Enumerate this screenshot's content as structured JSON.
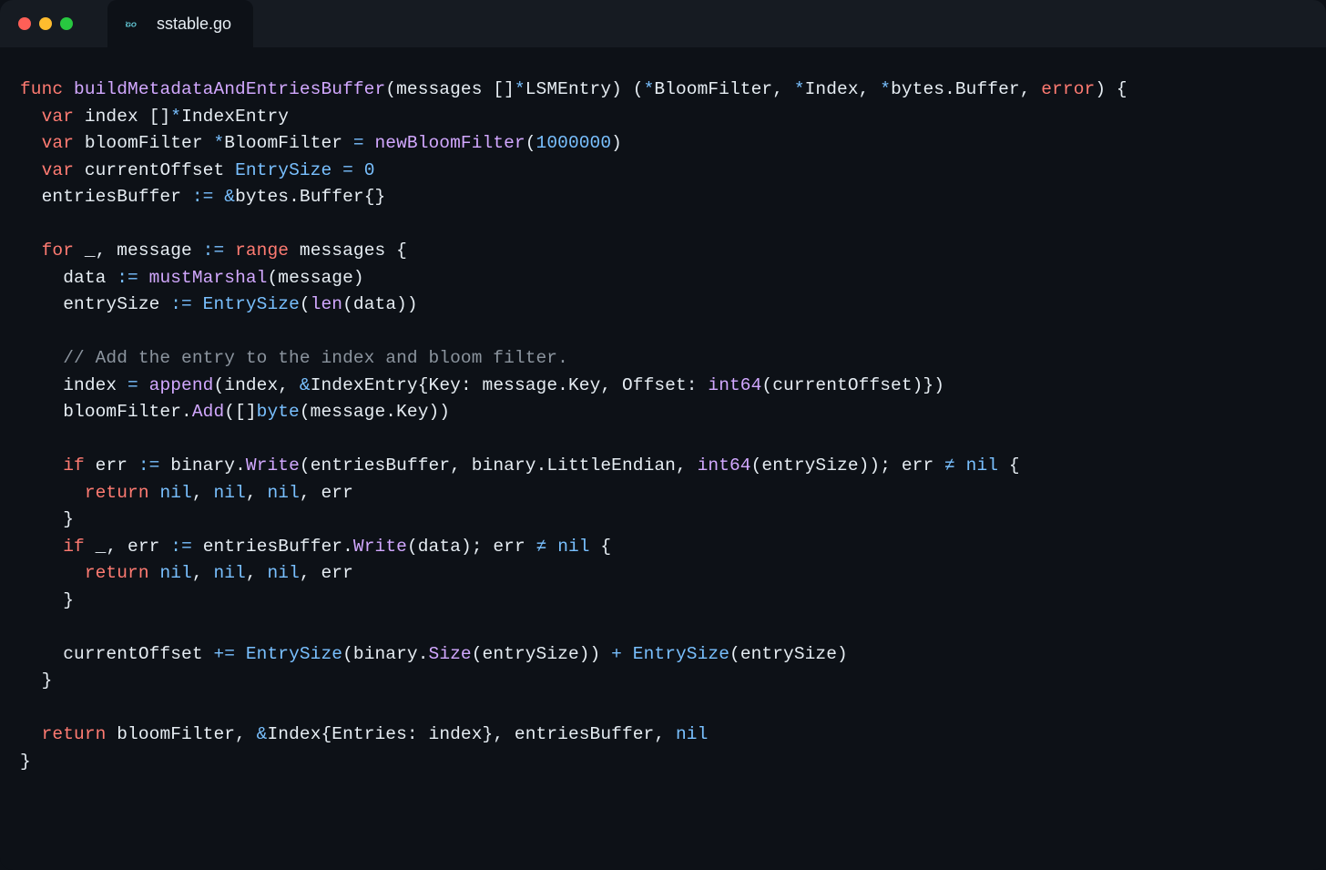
{
  "tab": {
    "filename": "sstable.go",
    "icon_label": "GO"
  },
  "code": {
    "l1": {
      "kw_func": "func",
      "fn": "buildMetadataAndEntriesBuffer",
      "params": "(messages []",
      "star1": "*",
      "t1": "LSMEntry",
      "close": ") (",
      "star2": "*",
      "t2": "BloomFilter",
      "c1": ", ",
      "star3": "*",
      "t3": "Index",
      "c2": ", ",
      "star4": "*",
      "t4": "bytes.Buffer",
      "c3": ", ",
      "err": "error",
      "end": ") {"
    },
    "l2": {
      "indent": "  ",
      "kw": "var",
      "sp": " ",
      "id": "index []",
      "star": "*",
      "typ": "IndexEntry"
    },
    "l3": {
      "indent": "  ",
      "kw": "var",
      "sp": " ",
      "id": "bloomFilter ",
      "star": "*",
      "typ": "BloomFilter",
      "eq": " = ",
      "fn": "newBloomFilter",
      "open": "(",
      "num": "1000000",
      "close": ")"
    },
    "l4": {
      "indent": "  ",
      "kw": "var",
      "sp": " ",
      "id": "currentOffset ",
      "typ": "EntrySize",
      "eq": " = ",
      "num": "0"
    },
    "l5": {
      "indent": "  ",
      "id": "entriesBuffer ",
      "op": ":=",
      "sp": " ",
      "amp": "&",
      "typ": "bytes.Buffer",
      "br": "{}"
    },
    "l6": "",
    "l7": {
      "indent": "  ",
      "kw_for": "for",
      "sp": " ",
      "us": "_, message ",
      "op": ":=",
      "sp2": " ",
      "kw_range": "range",
      "sp3": " ",
      "id": "messages {"
    },
    "l8": {
      "indent": "    ",
      "id": "data ",
      "op": ":=",
      "sp": " ",
      "fn": "mustMarshal",
      "args": "(message)"
    },
    "l9": {
      "indent": "    ",
      "id": "entrySize ",
      "op": ":=",
      "sp": " ",
      "typ": "EntrySize",
      "open": "(",
      "fn": "len",
      "args": "(data))"
    },
    "l10": "",
    "l11": {
      "indent": "    ",
      "cmt": "// Add the entry to the index and bloom filter."
    },
    "l12": {
      "indent": "    ",
      "id": "index ",
      "eq": "=",
      "sp": " ",
      "fn": "append",
      "open": "(index, ",
      "amp": "&",
      "typ": "IndexEntry",
      "body": "{Key: message.Key, Offset: ",
      "fn2": "int64",
      "args": "(currentOffset)})"
    },
    "l13": {
      "indent": "    ",
      "id": "bloomFilter.",
      "fn": "Add",
      "open": "([]",
      "typ": "byte",
      "args": "(message.Key))"
    },
    "l14": "",
    "l15": {
      "indent": "    ",
      "kw": "if",
      "sp": " ",
      "id": "err ",
      "op": ":=",
      "sp2": " ",
      "id2": "binary.",
      "fn": "Write",
      "args": "(entriesBuffer, binary.LittleEndian, ",
      "fn2": "int64",
      "args2": "(entrySize)); err ",
      "neq": "≠",
      "sp3": " ",
      "nil": "nil",
      "end": " {"
    },
    "l16": {
      "indent": "      ",
      "kw": "return",
      "sp": " ",
      "nil1": "nil",
      "c1": ", ",
      "nil2": "nil",
      "c2": ", ",
      "nil3": "nil",
      "c3": ", err"
    },
    "l17": {
      "indent": "    ",
      "br": "}"
    },
    "l18": {
      "indent": "    ",
      "kw": "if",
      "sp": " ",
      "id": "_, err ",
      "op": ":=",
      "sp2": " ",
      "id2": "entriesBuffer.",
      "fn": "Write",
      "args": "(data); err ",
      "neq": "≠",
      "sp3": " ",
      "nil": "nil",
      "end": " {"
    },
    "l19": {
      "indent": "      ",
      "kw": "return",
      "sp": " ",
      "nil1": "nil",
      "c1": ", ",
      "nil2": "nil",
      "c2": ", ",
      "nil3": "nil",
      "c3": ", err"
    },
    "l20": {
      "indent": "    ",
      "br": "}"
    },
    "l21": "",
    "l22": {
      "indent": "    ",
      "id": "currentOffset ",
      "op": "+=",
      "sp": " ",
      "typ": "EntrySize",
      "open": "(binary.",
      "fn": "Size",
      "args": "(entrySize)) ",
      "plus": "+",
      "sp2": " ",
      "typ2": "EntrySize",
      "args2": "(entrySize)"
    },
    "l23": {
      "indent": "  ",
      "br": "}"
    },
    "l24": "",
    "l25": {
      "indent": "  ",
      "kw": "return",
      "sp": " ",
      "id": "bloomFilter, ",
      "amp": "&",
      "typ": "Index",
      "body": "{Entries: index}, entriesBuffer, ",
      "nil": "nil"
    },
    "l26": {
      "br": "}"
    }
  }
}
